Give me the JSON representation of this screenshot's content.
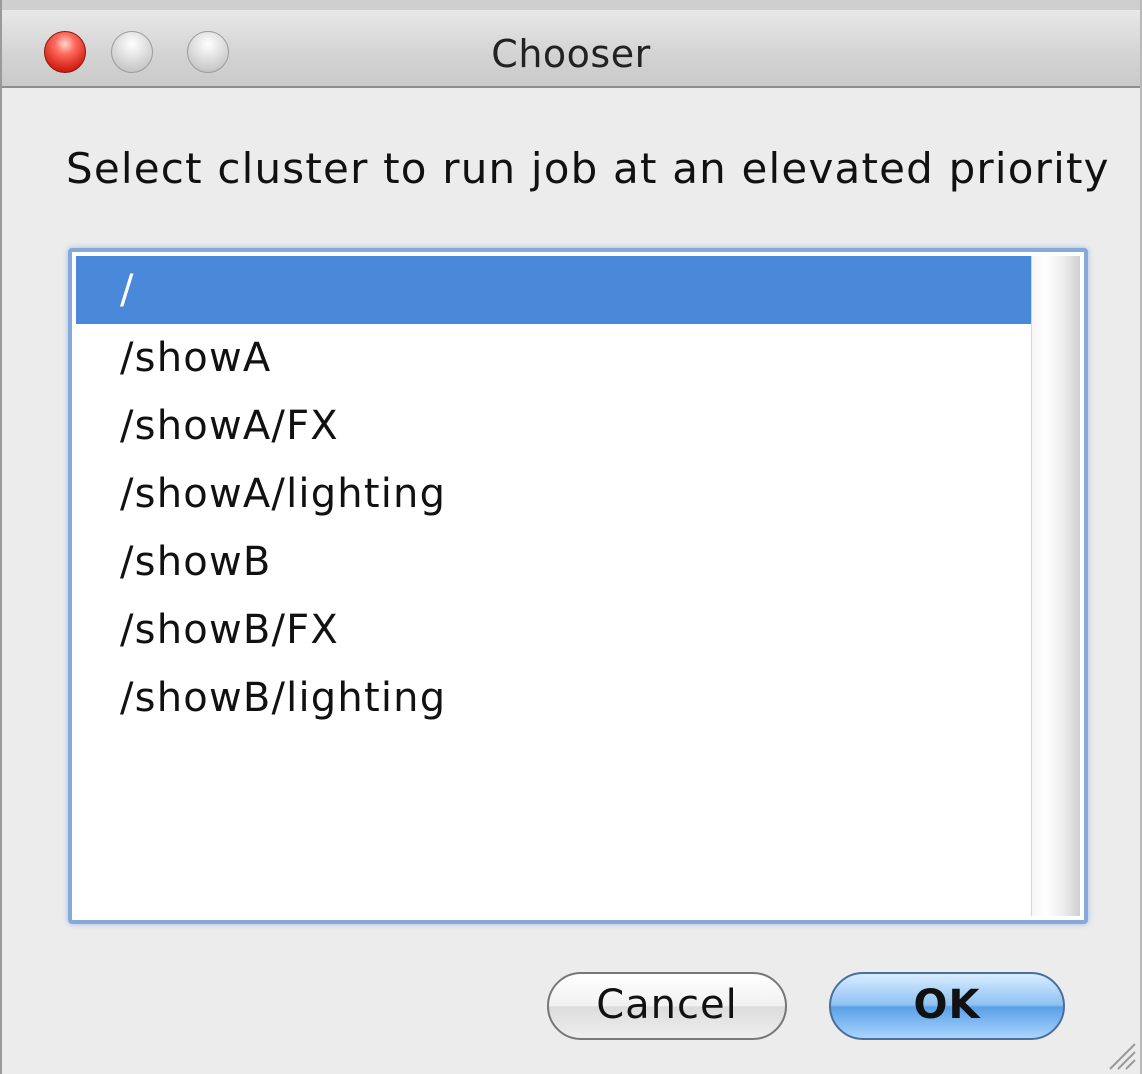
{
  "window": {
    "title": "Chooser"
  },
  "prompt": "Select cluster to run job at an elevated priority",
  "list": {
    "items": [
      "/",
      "/showA",
      "/showA/FX",
      "/showA/lighting",
      "/showB",
      "/showB/FX",
      "/showB/lighting"
    ],
    "selected_index": 0
  },
  "buttons": {
    "cancel_label": "Cancel",
    "ok_label": "OK"
  },
  "colors": {
    "selection": "#4a88d9",
    "focus_ring": "#86a9d9",
    "close_button": "#d8261a"
  }
}
